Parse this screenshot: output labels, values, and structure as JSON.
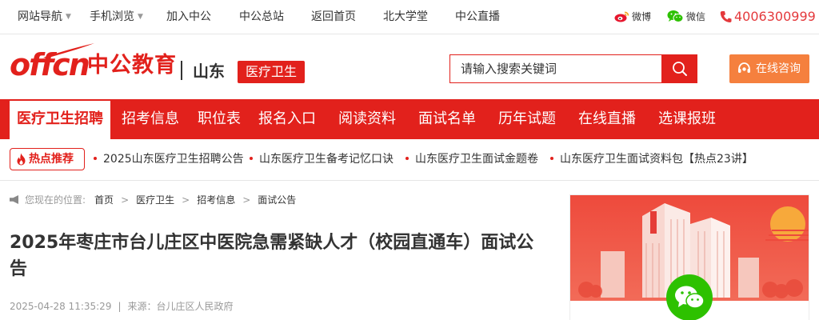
{
  "topbar": {
    "links": [
      {
        "label": "网站导航",
        "dropdown": true
      },
      {
        "label": "手机浏览",
        "dropdown": true
      },
      {
        "label": "加入中公",
        "dropdown": false
      },
      {
        "label": "中公总站",
        "dropdown": false
      },
      {
        "label": "返回首页",
        "dropdown": false
      },
      {
        "label": "北大学堂",
        "dropdown": false
      },
      {
        "label": "中公直播",
        "dropdown": false
      }
    ],
    "weibo": "微博",
    "weixin": "微信",
    "phone": "4006300999"
  },
  "header": {
    "logo_en": "offcn",
    "logo_cn": "中公教育",
    "region": "山东",
    "channel_tag": "医疗卫生",
    "search_placeholder": "请输入搜索关键词",
    "consult_label": "在线咨询"
  },
  "nav": {
    "items": [
      "医疗卫生招聘",
      "招考信息",
      "职位表",
      "报名入口",
      "阅读资料",
      "面试名单",
      "历年试题",
      "在线直播",
      "选课报班"
    ],
    "active_index": 0
  },
  "hot": {
    "badge": "热点推荐",
    "links": [
      "2025山东医疗卫生招聘公告",
      "山东医疗卫生备考记忆口诀",
      "山东医疗卫生面试金题卷",
      "山东医疗卫生面试资料包【热点23讲】"
    ]
  },
  "breadcrumb": {
    "prefix": "您现在的位置:",
    "items": [
      "首页",
      "医疗卫生",
      "招考信息",
      "面试公告"
    ],
    "separator": ">"
  },
  "article": {
    "title": "2025年枣庄市台儿庄区中医院急需紧缺人才（校园直通车）面试公告",
    "datetime": "2025-04-28 11:35:29",
    "separator": "|",
    "source": "来源：台儿庄区人民政府"
  },
  "colors": {
    "brand_red": "#e2211c",
    "consult_orange": "#f5803e",
    "phone_red": "#e4393c",
    "wechat_green": "#2dc100"
  },
  "icons": [
    "chevron-down-icon",
    "weibo-icon",
    "wechat-icon",
    "phone-icon",
    "search-icon",
    "headset-icon",
    "flame-icon",
    "speaker-icon"
  ]
}
